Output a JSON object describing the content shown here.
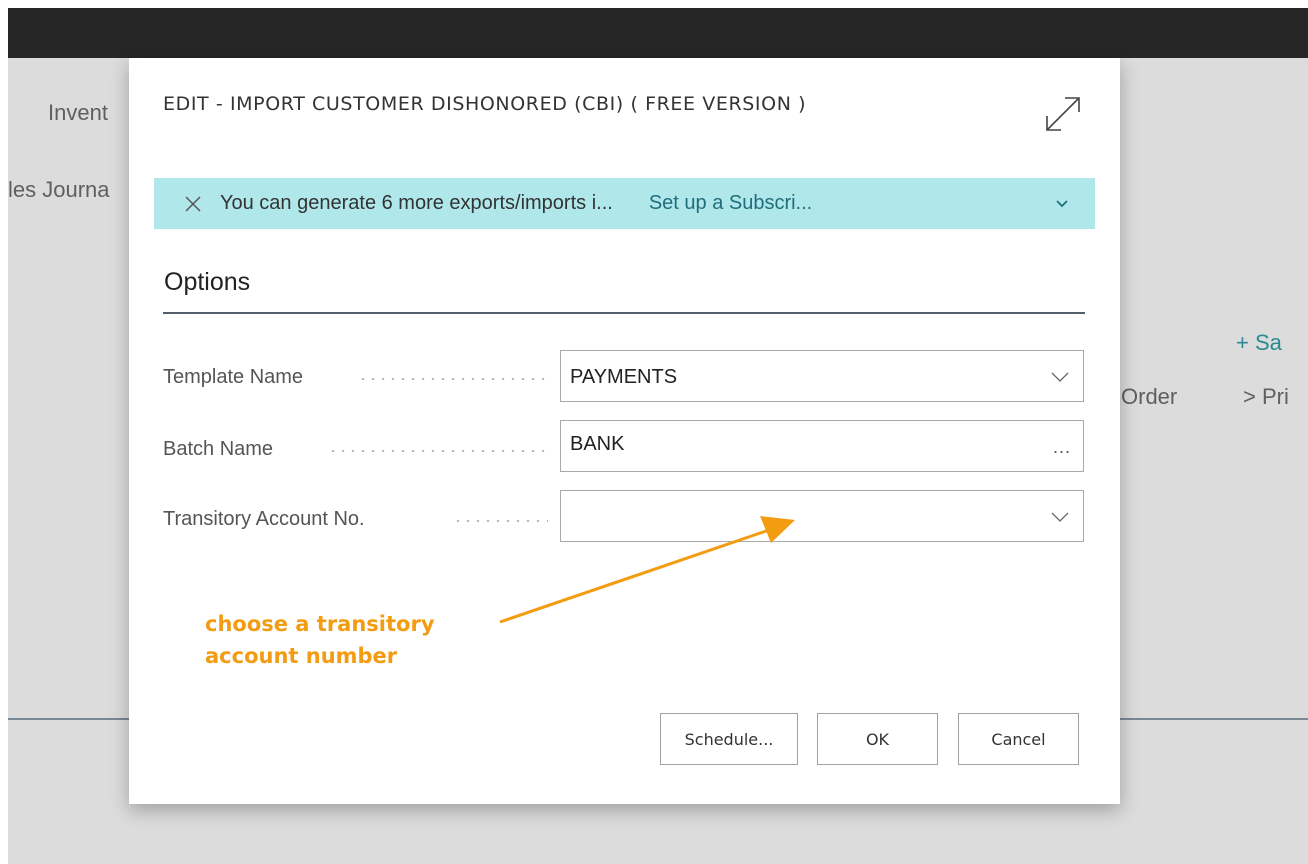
{
  "background": {
    "inventory_text": "Invent",
    "sales_journal_text": "les Journa",
    "order_text": "Order",
    "new_sales_text": "+ Sa",
    "print_text": "> Pri"
  },
  "dialog": {
    "title": "EDIT - IMPORT CUSTOMER DISHONORED (CBI) ( FREE VERSION )",
    "banner": {
      "message": "You can generate 6 more exports/imports i...",
      "link": "Set up a Subscri..."
    },
    "section_title": "Options",
    "fields": {
      "template_name": {
        "label": "Template Name",
        "value": "PAYMENTS"
      },
      "batch_name": {
        "label": "Batch Name",
        "value": "BANK",
        "lookup": "..."
      },
      "transitory_account": {
        "label": "Transitory Account No.",
        "value": ""
      }
    },
    "annotation": {
      "line1": "choose a transitory",
      "line2": "account number",
      "color": "#f39c12"
    },
    "buttons": {
      "schedule": "Schedule...",
      "ok": "OK",
      "cancel": "Cancel"
    }
  },
  "colors": {
    "topbar": "#262626",
    "banner": "#afe7ea",
    "banner_link": "#1f6f7b",
    "accent_annotation": "#f39c12"
  },
  "icons": {
    "expand": "expand-icon",
    "banner_close": "close-icon",
    "banner_chevron": "chevron-down-icon",
    "dropdown": "chevron-down-icon",
    "new": "plus-icon",
    "more": "chevron-right-icon"
  }
}
